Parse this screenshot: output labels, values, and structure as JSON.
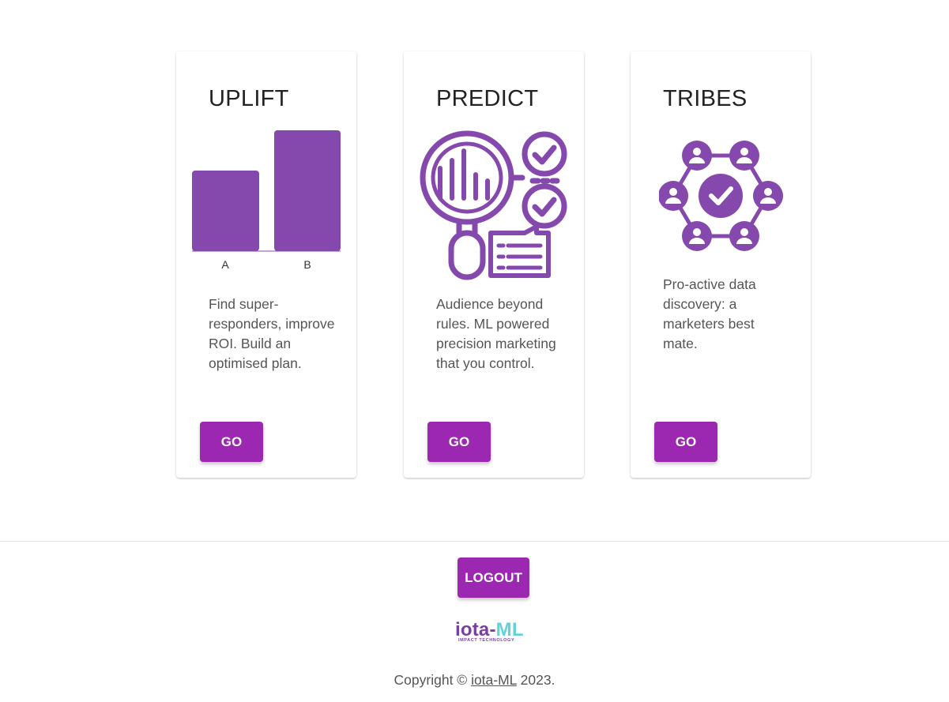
{
  "cards": [
    {
      "title": "UPLIFT",
      "description": "Find super-responders, improve ROI. Build an optimised plan.",
      "button_label": "GO",
      "chart_labels": [
        "A",
        "B"
      ]
    },
    {
      "title": "PREDICT",
      "description": "Audience beyond rules. ML powered precision marketing that you control.",
      "button_label": "GO"
    },
    {
      "title": "TRIBES",
      "description": "Pro-active data discovery: a marketers best mate.",
      "button_label": "GO"
    }
  ],
  "footer": {
    "logout_label": "LOGOUT",
    "logo": {
      "main_iota": "iota-",
      "main_ml": "ML",
      "sub": "IMPACT TECHNOLOGY"
    },
    "copyright_prefix": "Copyright © ",
    "copyright_link": "iota-ML",
    "copyright_suffix": " 2023."
  },
  "colors": {
    "accent": "#9c27b0",
    "icon": "#8548ad",
    "logo_ml": "#5fd3d9"
  }
}
